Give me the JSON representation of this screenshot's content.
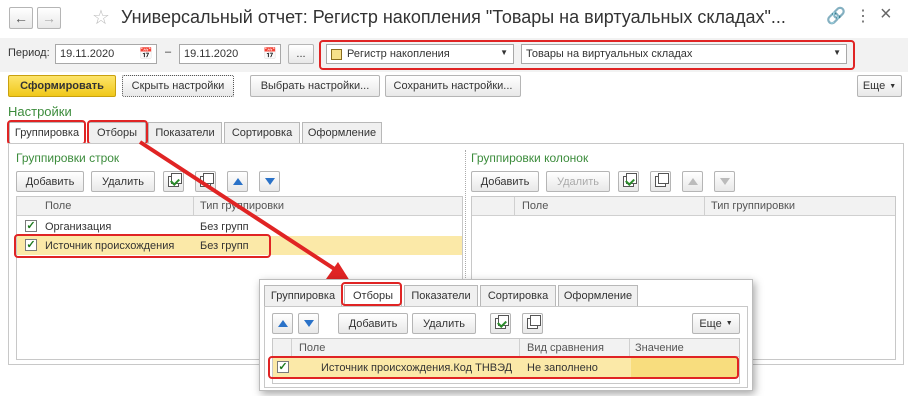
{
  "window": {
    "title": "Универсальный отчет: Регистр накопления \"Товары на виртуальных складах\"...",
    "more_glyph": "⋮",
    "close_glyph": "×"
  },
  "period": {
    "label": "Период:",
    "from": "19.11.2020",
    "dash": "–",
    "to": "19.11.2020",
    "ellipsis_label": "..."
  },
  "source": {
    "type_value": "Регистр накопления",
    "object_value": "Товары на виртуальных складах"
  },
  "toolbar": {
    "generate": "Сформировать",
    "hide_settings": "Скрыть настройки",
    "choose_settings": "Выбрать настройки...",
    "save_settings": "Сохранить настройки...",
    "more": "Еще"
  },
  "settings": {
    "title": "Настройки",
    "tabs": [
      "Группировка",
      "Отборы",
      "Показатели",
      "Сортировка",
      "Оформление"
    ]
  },
  "row_groups": {
    "title": "Группировки строк",
    "add": "Добавить",
    "delete": "Удалить",
    "col_field": "Поле",
    "col_type": "Тип группировки",
    "rows": [
      {
        "field": "Организация",
        "type": "Без групп",
        "checked": true
      },
      {
        "field": "Источник происхождения",
        "type": "Без групп",
        "checked": true
      }
    ]
  },
  "col_groups": {
    "title": "Группировки колонок",
    "add": "Добавить",
    "delete": "Удалить",
    "col_field": "Поле",
    "col_type": "Тип группировки"
  },
  "filters_popup": {
    "tabs": [
      "Группировка",
      "Отборы",
      "Показатели",
      "Сортировка",
      "Оформление"
    ],
    "add": "Добавить",
    "delete": "Удалить",
    "more": "Еще",
    "col_field": "Поле",
    "col_compare": "Вид сравнения",
    "col_value": "Значение",
    "rows": [
      {
        "field": "Источник происхождения.Код ТНВЭД",
        "compare": "Не заполнено",
        "value": "",
        "checked": true
      }
    ]
  },
  "colors": {
    "accent_green": "#3c8c3c",
    "highlight_red": "#e02424",
    "generate_yellow": "#f5d32a",
    "row_highlight": "#fbe9a8"
  }
}
